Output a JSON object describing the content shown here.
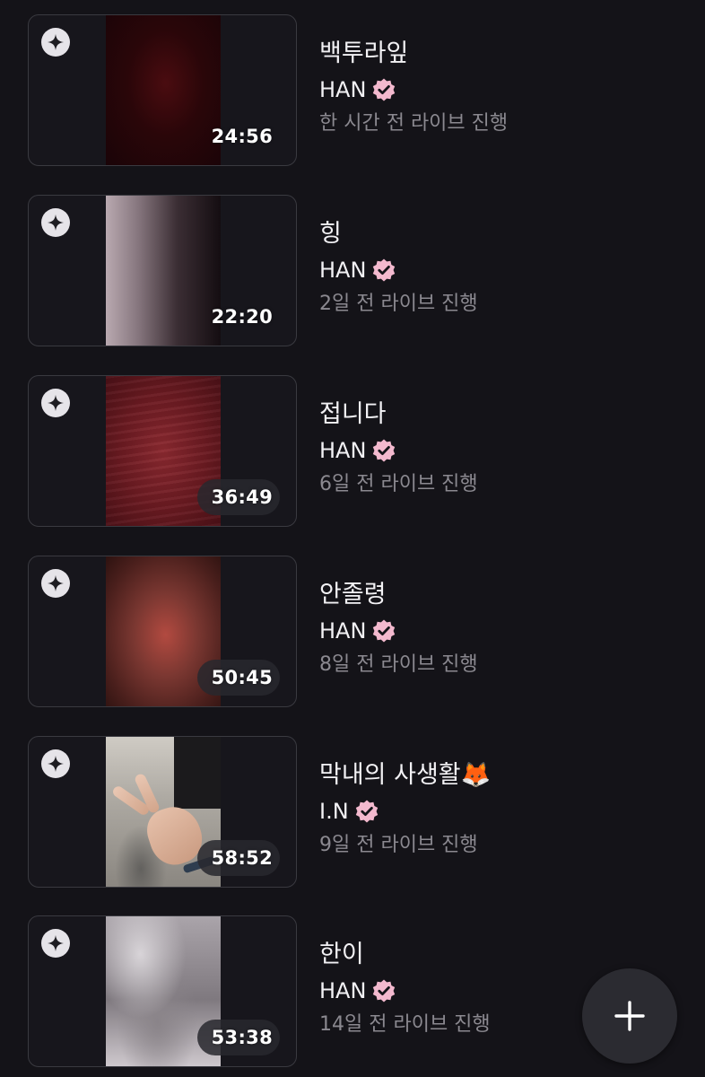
{
  "lives": [
    {
      "title": "백투라잎",
      "author": "HAN",
      "time_ago": "한 시간 전 라이브 진행",
      "duration": "24:56"
    },
    {
      "title": "힝",
      "author": "HAN",
      "time_ago": "2일 전 라이브 진행",
      "duration": "22:20"
    },
    {
      "title": "접니다",
      "author": "HAN",
      "time_ago": "6일 전 라이브 진행",
      "duration": "36:49"
    },
    {
      "title": "안졸령",
      "author": "HAN",
      "time_ago": "8일 전 라이브 진행",
      "duration": "50:45"
    },
    {
      "title": "막내의 사생활🦊",
      "author": "I.N",
      "time_ago": "9일 전 라이브 진행",
      "duration": "58:52"
    },
    {
      "title": "한이",
      "author": "HAN",
      "time_ago": "14일 전 라이브 진행",
      "duration": "53:38"
    }
  ],
  "icons": {
    "badge": "sparkle-icon",
    "verified": "verified-badge-icon",
    "fab": "plus-icon"
  },
  "colors": {
    "background": "#141318",
    "verified_badge": "#f3b9ce",
    "meta_text": "#8b8990"
  }
}
